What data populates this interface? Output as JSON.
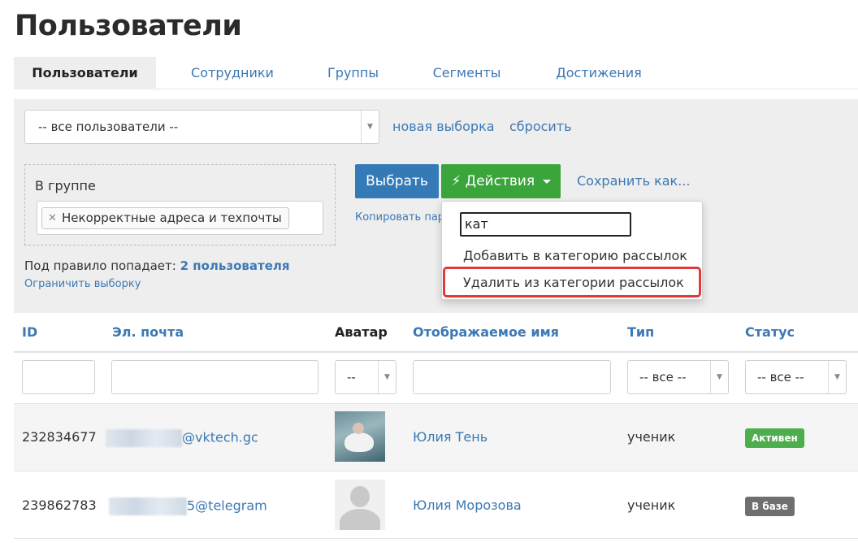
{
  "page_title": "Пользователи",
  "tabs": [
    "Пользователи",
    "Сотрудники",
    "Группы",
    "Сегменты",
    "Достижения"
  ],
  "filter": {
    "selection_value": "-- все пользователи --",
    "new_selection": "новая выборка",
    "reset": "сбросить",
    "rule_label": "В группе",
    "rule_tag": "Некорректные адреса и техпочты",
    "rule_count_prefix": "Под правило попадает:",
    "rule_count_value": "2 пользователя",
    "limit_link": "Ограничить выборку"
  },
  "actions": {
    "select_button": "Выбрать",
    "actions_button": "Действия",
    "save_as": "Сохранить как...",
    "copy_link": "Копировать пара"
  },
  "dropdown": {
    "search_value": "кат",
    "items": [
      "Добавить в категорию рассылок",
      "Удалить из категории рассылок"
    ],
    "highlight_color": "#e03a3a"
  },
  "table": {
    "headers": [
      "ID",
      "Эл. почта",
      "Аватар",
      "Отображаемое имя",
      "Тип",
      "Статус"
    ],
    "filters": {
      "avatar": "--",
      "type": "-- все --",
      "status": "-- все --"
    },
    "rows": [
      {
        "id": "232834677",
        "email": "@vktech.gc",
        "name": "Юлия Тень",
        "type": "ученик",
        "status": "Активен",
        "status_color": "#4cae4c"
      },
      {
        "id": "239862783",
        "email": "5@telegram",
        "name": "Юлия Морозова",
        "type": "ученик",
        "status": "В базе",
        "status_color": "#6f6f6f"
      }
    ]
  }
}
